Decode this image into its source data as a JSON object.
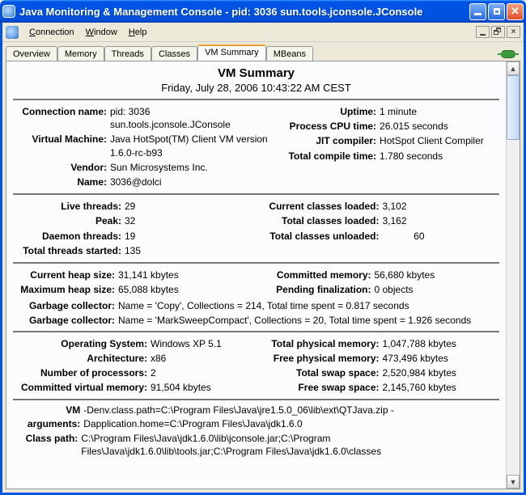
{
  "window": {
    "title": "Java Monitoring & Management Console - pid: 3036 sun.tools.jconsole.JConsole"
  },
  "menu": {
    "connection": "Connection",
    "window": "Window",
    "help": "Help"
  },
  "tabs": {
    "overview": "Overview",
    "memory": "Memory",
    "threads": "Threads",
    "classes": "Classes",
    "vmsummary": "VM Summary",
    "mbeans": "MBeans"
  },
  "summary": {
    "title": "VM Summary",
    "date": "Friday, July 28, 2006 10:43:22 AM CEST",
    "conn": {
      "connection_name_label": "Connection name:",
      "connection_name": "pid: 3036 sun.tools.jconsole.JConsole",
      "virtual_machine_label": "Virtual Machine:",
      "virtual_machine": "Java HotSpot(TM) Client VM version 1.6.0-rc-b93",
      "vendor_label": "Vendor:",
      "vendor": "Sun Microsystems Inc.",
      "name_label": "Name:",
      "name": "3036@dolci",
      "uptime_label": "Uptime:",
      "uptime": "1 minute",
      "cpu_time_label": "Process CPU time:",
      "cpu_time": "26.015 seconds",
      "jit_label": "JIT compiler:",
      "jit": "HotSpot Client Compiler",
      "compile_time_label": "Total compile time:",
      "compile_time": "1.780 seconds"
    },
    "threads": {
      "live_label": "Live threads:",
      "live": "29",
      "peak_label": "Peak:",
      "peak": "32",
      "daemon_label": "Daemon threads:",
      "daemon": "19",
      "started_label": "Total threads started:",
      "started": "135",
      "classes_loaded_label": "Current classes loaded:",
      "classes_loaded": "3,102",
      "classes_total_label": "Total classes loaded:",
      "classes_total": "3,162",
      "classes_unloaded_label": "Total classes unloaded:",
      "classes_unloaded": "60"
    },
    "memory": {
      "heap_label": "Current heap size:",
      "heap": "31,141 kbytes",
      "maxheap_label": "Maximum heap size:",
      "maxheap": "65,088 kbytes",
      "committed_label": "Committed memory:",
      "committed": "56,680 kbytes",
      "pending_label": "Pending finalization:",
      "pending": "0 objects",
      "gc_label": "Garbage collector:",
      "gc1": "Name = 'Copy', Collections = 214, Total time spent = 0.817 seconds",
      "gc2": "Name = 'MarkSweepCompact', Collections = 20, Total time spent = 1.926 seconds"
    },
    "system": {
      "os_label": "Operating System:",
      "os": "Windows XP 5.1",
      "arch_label": "Architecture:",
      "arch": "x86",
      "procs_label": "Number of processors:",
      "procs": "2",
      "cvm_label": "Committed virtual memory:",
      "cvm": "91,504 kbytes",
      "tp_label": "Total physical memory:",
      "tp": "1,047,788 kbytes",
      "fp_label": "Free physical memory:",
      "fp": "473,496 kbytes",
      "ts_label": "Total swap space:",
      "ts": "2,520,984 kbytes",
      "fs_label": "Free swap space:",
      "fs": "2,145,760 kbytes"
    },
    "paths": {
      "vmargs_label": "VM arguments:",
      "vmargs": "-Denv.class.path=C:\\Program Files\\Java\\jre1.5.0_06\\lib\\ext\\QTJava.zip -Dapplication.home=C:\\Program Files\\Java\\jdk1.6.0",
      "classpath_label": "Class path:",
      "classpath": "C:\\Program Files\\Java\\jdk1.6.0\\lib\\jconsole.jar;C:\\Program Files\\Java\\jdk1.6.0\\lib\\tools.jar;C:\\Program Files\\Java\\jdk1.6.0\\classes"
    }
  }
}
